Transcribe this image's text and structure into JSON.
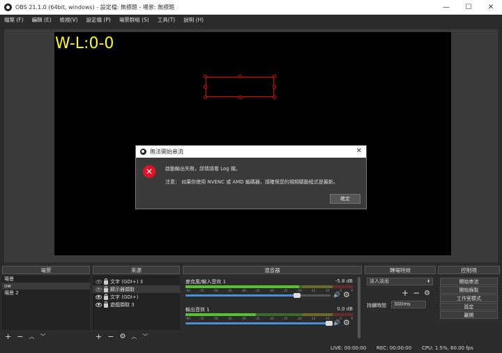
{
  "window": {
    "title": "OBS 21.1.0 (64bit, windows) - 設定檔: 無標題 - 場景: 無標題",
    "minimize": "—",
    "maximize": "☐",
    "close": "✕"
  },
  "menu": [
    "檔案 (F)",
    "編輯 (E)",
    "檢視(V)",
    "設定檔 (P)",
    "場景群組 (S)",
    "工具(T)",
    "說明 (H)"
  ],
  "preview": {
    "overlay_text": "W-L:0-0"
  },
  "dialog": {
    "title": "無法開始串流",
    "close": "✕",
    "icon": "✕",
    "message1": "啟動輸出失敗，詳情請看 Log 檔。",
    "message2": "注意： 如果你使用 NVENC 或 AMD 編碼器，請確保您的視頻驅動程式是最新。",
    "ok": "確定"
  },
  "scenes": {
    "header": "場景",
    "items": [
      "場景",
      "ow",
      "場景 2"
    ],
    "selected_index": 1
  },
  "sources": {
    "header": "來源",
    "items": [
      "文字 (GDI+) 3",
      "顯示器擷取",
      "文字 (GDI+)",
      "遊戲擷取 3"
    ],
    "selected_index": 1
  },
  "mixer": {
    "header": "混音器",
    "channels": [
      {
        "name": "麥克風/輸入音效 1",
        "db": "-5.8 dB",
        "level": 0.68,
        "volume": 0.77
      },
      {
        "name": "輸出音效 1",
        "db": "0.0 dB",
        "level": 0.42,
        "volume": 0.99
      }
    ],
    "ticks": [
      "-60",
      "-55",
      "-50",
      "-45",
      "-40",
      "-35",
      "-30",
      "-25",
      "-20",
      "-15",
      "-10",
      "-5",
      "0"
    ]
  },
  "transitions": {
    "header": "轉場特效",
    "selected": "淡入淡出",
    "duration_label": "持續時間",
    "duration_value": "300ms"
  },
  "controls": {
    "header": "控制項",
    "buttons": [
      "開始串流",
      "開始錄製",
      "工作室模式",
      "設定",
      "離開"
    ]
  },
  "status": {
    "live": "LIVE: 00:00:00",
    "rec": "REC: 00:00:00",
    "cpu": "CPU: 1.5%, 60.00 fps"
  },
  "icons": {
    "add": "+",
    "remove": "−",
    "up": "︿",
    "down": "﹀",
    "gear": "⚙",
    "speaker": "🔊"
  }
}
